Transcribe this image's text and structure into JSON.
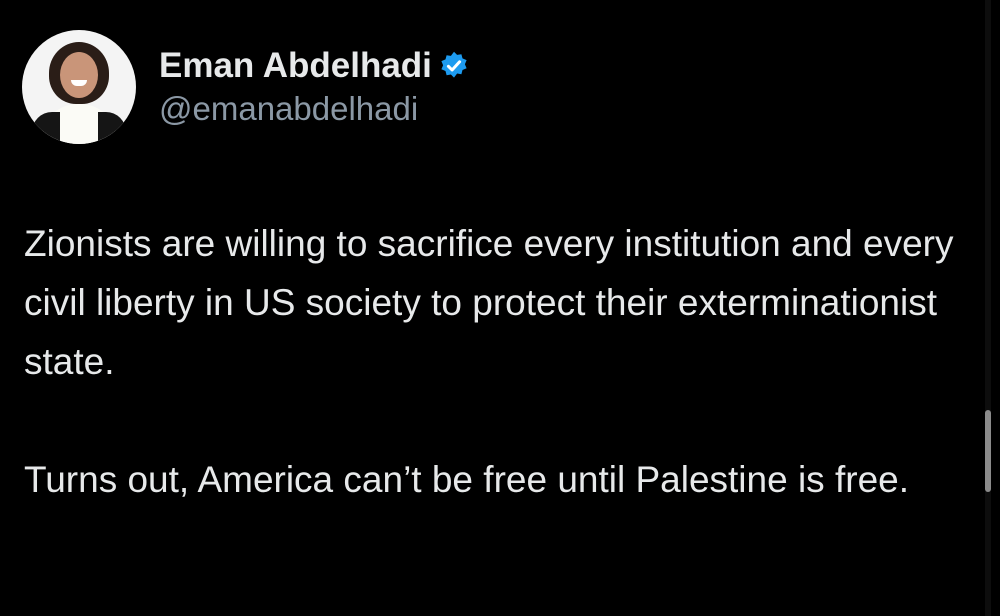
{
  "tweet": {
    "author": {
      "display_name": "Eman Abdelhadi",
      "handle": "@emanabdelhadi",
      "verified_icon": "verified-badge-icon",
      "avatar_icon": "profile-photo-icon"
    },
    "paragraphs": [
      "Zionists are willing to sacrifice every institution and every civil liberty in US society to protect their exterminationist state.",
      "Turns out, America can’t be free until Palestine is free."
    ]
  },
  "colors": {
    "background": "#000000",
    "text": "#e7e9ea",
    "secondary_text": "#8b98a5",
    "verified": "#1d9bf0"
  }
}
